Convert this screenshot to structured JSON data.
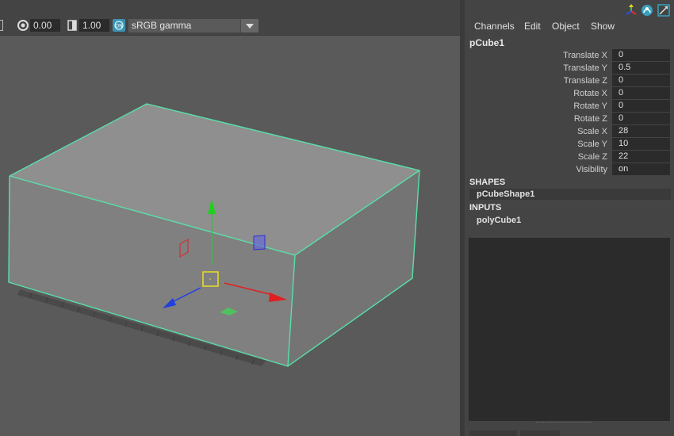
{
  "toolbar": {
    "exposure_value": "0.00",
    "gamma_value": "1.00",
    "color_space": "sRGB gamma"
  },
  "panel": {
    "menu": [
      "Channels",
      "Edit",
      "Object",
      "Show"
    ],
    "node_name": "pCube1",
    "channels": [
      {
        "label": "Translate X",
        "value": "0"
      },
      {
        "label": "Translate Y",
        "value": "0.5"
      },
      {
        "label": "Translate Z",
        "value": "0"
      },
      {
        "label": "Rotate X",
        "value": "0"
      },
      {
        "label": "Rotate Y",
        "value": "0"
      },
      {
        "label": "Rotate Z",
        "value": "0"
      },
      {
        "label": "Scale X",
        "value": "28"
      },
      {
        "label": "Scale Y",
        "value": "10"
      },
      {
        "label": "Scale Z",
        "value": "22"
      },
      {
        "label": "Visibility",
        "value": "on"
      }
    ],
    "shapes_header": "SHAPES",
    "shape_item": "pCubeShape1",
    "inputs_header": "INPUTS",
    "input_item": "polyCube1"
  },
  "colors": {
    "selection_wireframe": "#58e0a8",
    "axis_x": "#e02020",
    "axis_y": "#20d020",
    "axis_z": "#2040e0",
    "pivot": "#e8e020"
  },
  "icons": [
    "exposure-icon",
    "gamma-icon",
    "color-management-icon",
    "tool-settings-icon",
    "attribute-editor-icon",
    "channel-box-icon"
  ]
}
